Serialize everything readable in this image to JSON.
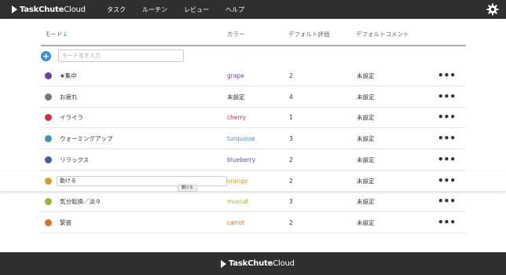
{
  "app": {
    "brand_bold": "TaskChute",
    "brand_light": "Cloud"
  },
  "nav": {
    "items": [
      "タスク",
      "ルーチン",
      "レビュー",
      "ヘルプ"
    ]
  },
  "table": {
    "headers": {
      "mode": "モード",
      "sort_arrow": "↓",
      "color": "カラー",
      "eval": "デフォルト評価",
      "comment": "デフォルトコメント"
    },
    "input": {
      "placeholder": "モード名を入力",
      "value": ""
    },
    "rows": [
      {
        "name": "★集中",
        "color_name": "grape",
        "color_hex": "#6b3fa0",
        "eval": "2",
        "comment": "未設定",
        "menu": "•••"
      },
      {
        "name": "お疲れ",
        "color_name": "未設定",
        "color_hex": "#7a7a7a",
        "eval": "4",
        "comment": "未設定",
        "menu": "•••"
      },
      {
        "name": "イライラ",
        "color_name": "cherry",
        "color_hex": "#d32f45",
        "eval": "1",
        "comment": "未設定",
        "menu": "•••"
      },
      {
        "name": "ウォーミングアップ",
        "color_name": "turquoise",
        "color_hex": "#3d97b8",
        "eval": "3",
        "comment": "未設定",
        "menu": "•••"
      },
      {
        "name": "リラックス",
        "color_name": "blueberry",
        "color_hex": "#4a5aa8",
        "eval": "2",
        "comment": "未設定",
        "menu": "•••"
      },
      {
        "name": "動ける",
        "color_name": "orange",
        "color_hex": "#d99a2b",
        "eval": "2",
        "comment": "未設定",
        "menu": "•••"
      },
      {
        "name": "気分転換／淡々",
        "color_name": "muscat",
        "color_hex": "#9bb52e",
        "eval": "3",
        "comment": "未設定",
        "menu": "•••"
      },
      {
        "name": "緊張",
        "color_name": "carrot",
        "color_hex": "#e07028",
        "eval": "2",
        "comment": "未設定",
        "menu": "•••"
      }
    ],
    "tooltip": "動ける"
  }
}
